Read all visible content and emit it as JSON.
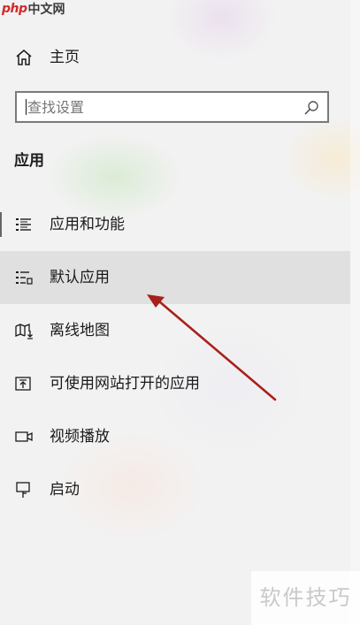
{
  "watermark": {
    "logo_php": "php",
    "logo_zh": "中文网",
    "corner_text": "软件技巧"
  },
  "home": {
    "label": "主页",
    "icon": "home-icon"
  },
  "search": {
    "placeholder": "查找设置",
    "value": "",
    "icon": "search-icon"
  },
  "section": {
    "title": "应用"
  },
  "nav": {
    "items": [
      {
        "label": "应用和功能",
        "icon": "apps-features-icon",
        "selected": false,
        "indicator": true
      },
      {
        "label": "默认应用",
        "icon": "default-apps-icon",
        "selected": true,
        "indicator": false
      },
      {
        "label": "离线地图",
        "icon": "offline-maps-icon",
        "selected": false,
        "indicator": false
      },
      {
        "label": "可使用网站打开的应用",
        "icon": "apps-for-websites-icon",
        "selected": false,
        "indicator": false
      },
      {
        "label": "视频播放",
        "icon": "video-playback-icon",
        "selected": false,
        "indicator": false
      },
      {
        "label": "启动",
        "icon": "startup-icon",
        "selected": false,
        "indicator": false
      }
    ]
  },
  "colors": {
    "background": "#f2f2f2",
    "selected_row": "#dadada",
    "annotation_arrow": "#a8201a",
    "logo_red": "#d42a2a"
  }
}
